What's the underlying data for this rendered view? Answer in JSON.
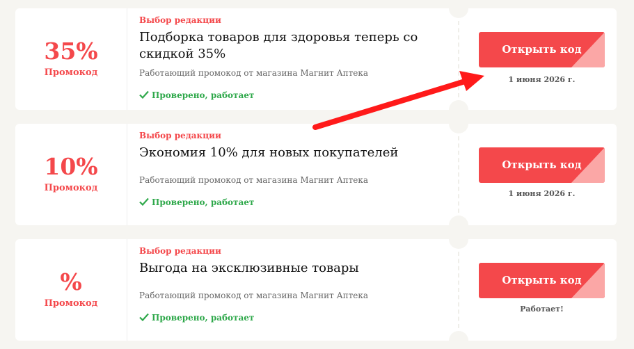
{
  "colors": {
    "accent": "#f4484b",
    "accent_light": "#fba7a6",
    "success": "#2ea84a",
    "background": "#f6f5f1",
    "annotation_arrow": "#ff1a1a"
  },
  "coupons": [
    {
      "discount": "35%",
      "discount_label": "Промокод",
      "badge": "Выбор редакции",
      "title": "Подборка товаров для здоровья теперь со скидкой 35%",
      "description": "Работающий промокод от магазина Магнит Аптека",
      "verified": "Проверено, работает",
      "button_label": "Открыть код",
      "expiry": "1 июня 2026 г."
    },
    {
      "discount": "10%",
      "discount_label": "Промокод",
      "badge": "Выбор редакции",
      "title": "Экономия 10% для новых покупателей",
      "description": "Работающий промокод от магазина Магнит Аптека",
      "verified": "Проверено, работает",
      "button_label": "Открыть код",
      "expiry": "1 июня 2026 г."
    },
    {
      "discount": "%",
      "discount_label": "Промокод",
      "badge": "Выбор редакции",
      "title": "Выгода на эксклюзивные товары",
      "description": "Работающий промокод от магазина Магнит Аптека",
      "verified": "Проверено, работает",
      "button_label": "Открыть код",
      "expiry": "Работает!"
    }
  ],
  "icons": {
    "verified": "check-icon",
    "annotation": "red-arrow-icon"
  }
}
